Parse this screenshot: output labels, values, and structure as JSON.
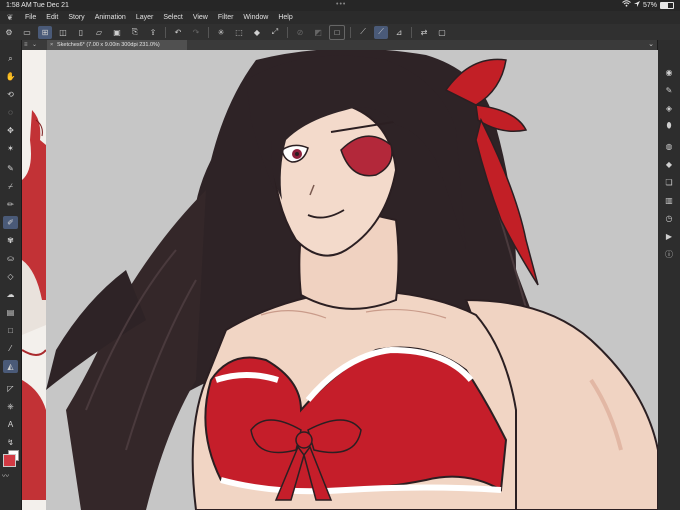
{
  "status": {
    "time": "1:58 AM",
    "date": "Tue Dec 21",
    "dots": "•••",
    "battery": "57%",
    "battery_level": 0.57
  },
  "menu": [
    "File",
    "Edit",
    "Story",
    "Animation",
    "Layer",
    "Select",
    "View",
    "Filter",
    "Window",
    "Help"
  ],
  "tab": {
    "title": "Sketches6* (7.00 x 9.00in 300dpi 231.0%)",
    "close": "×"
  },
  "colors": {
    "main": "#d23a44",
    "sub": "#ffffff",
    "canvas_bg": "#c6c6c6",
    "active_tool": "#4a5a78"
  },
  "icons": {
    "left_tools": [
      "zoom-icon",
      "hand-icon",
      "rotate-icon",
      "lasso-icon",
      "move-icon",
      "magic-wand-icon",
      "pen-icon",
      "eyedropper-icon",
      "pencil-icon",
      "brush-icon",
      "airbrush-icon",
      "fill-icon",
      "eraser-icon",
      "blend-icon",
      "gradient-icon",
      "shape-icon",
      "watercolor-icon",
      "decoration-icon",
      "ruler-icon",
      "layer-icon",
      "text-icon",
      "balloon-icon"
    ],
    "right_tools": [
      "navigator-icon",
      "tool-property-icon",
      "subtool-icon",
      "brush-size-icon",
      "color-wheel-icon",
      "layer-property-icon",
      "layers-icon",
      "material-icon",
      "history-icon",
      "auto-action-icon",
      "info-icon"
    ]
  }
}
